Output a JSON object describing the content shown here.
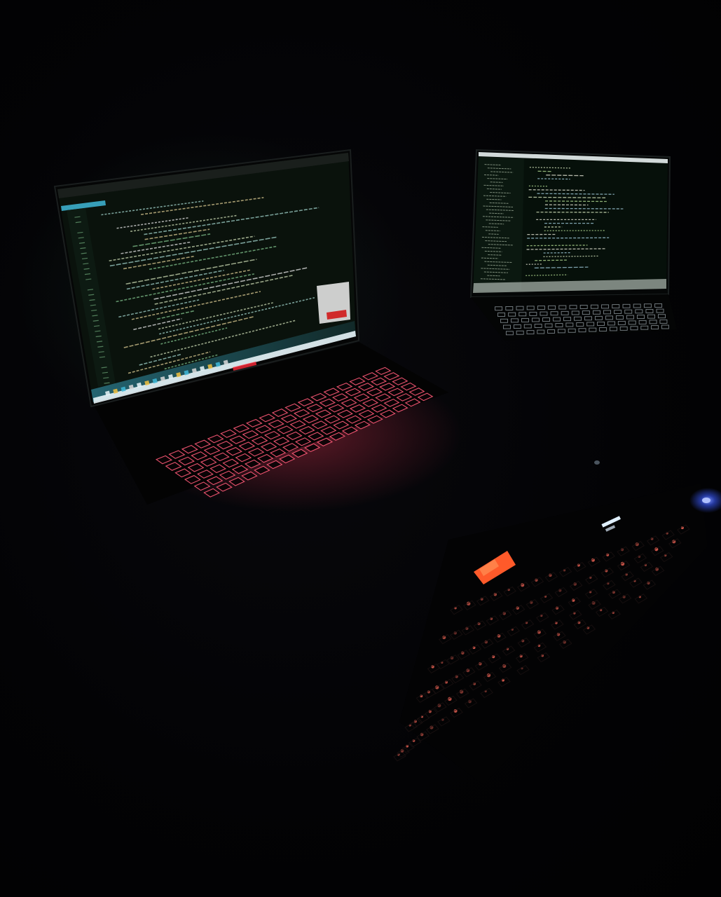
{
  "scene": {
    "description_free": true,
    "left_laptop": {
      "screen_background": "#0a120c",
      "code_colors": [
        "#c8d7b0",
        "#9fd0c8",
        "#d8c890",
        "#7fbf8a",
        "#e0e0e0"
      ],
      "taskbar_color": "#3fb8d8",
      "keyboard_backlight": "#ff5a78",
      "logo_glow": "#ff2a3a"
    },
    "right_laptop": {
      "screen_background": "#06100a",
      "bezel_top": "#e8f0f0",
      "code_colors": [
        "#d8e8c0",
        "#b0d890",
        "#e0e0d0",
        "#9ec8d8"
      ],
      "keyboard_backlight": "#d8e8f0"
    },
    "desk_keyboard": {
      "backlight": "#ff6a5a",
      "highlight_key_color": "#ff5a2a",
      "indicator_color": "#e0f0ff",
      "mouse_led": "#3a5aff"
    }
  }
}
